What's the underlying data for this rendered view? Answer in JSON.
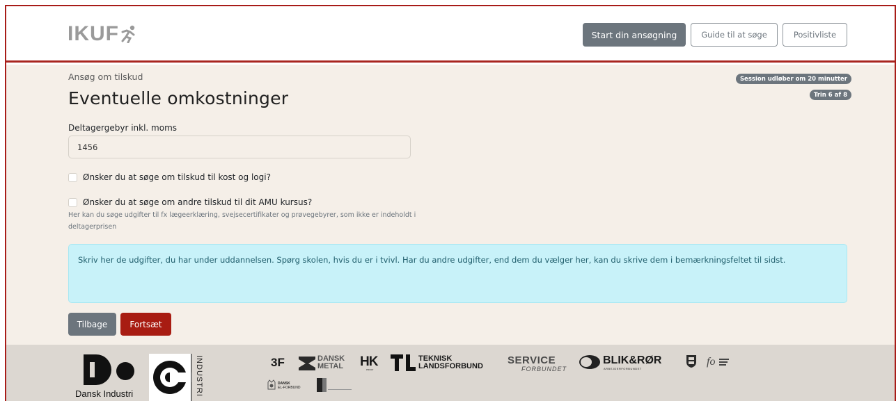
{
  "header": {
    "logo_text": "IKUF",
    "nav": {
      "start_label": "Start din ansøgning",
      "guide_label": "Guide til at søge",
      "list_label": "Positivliste"
    }
  },
  "main": {
    "breadcrumb": "Ansøg om tilskud",
    "title": "Eventuelle omkostninger",
    "session_badge": "Session udløber om 20 minutter",
    "step_badge": "Trin 6 af 8",
    "fee_field": {
      "label": "Deltagergebyr inkl. moms",
      "value": "1456"
    },
    "checkbox_1": {
      "label": "Ønsker du at søge om tilskud til kost og logi?",
      "checked": false
    },
    "checkbox_2": {
      "label": "Ønsker du at søge om andre tilskud til dit AMU kursus?",
      "checked": false,
      "help": "Her kan du søge udgifter til fx lægeerklæring, svejsecertifikater og prøvegebyrer, som ikke er indeholdt i deltagerprisen"
    },
    "info": "Skriv her de udgifter, du har under uddannelsen. Spørg skolen, hvis du er i tvivl. Har du andre udgifter, end dem du vælger her, kan du skrive dem i bemærkningsfeltet til sidst.",
    "buttons": {
      "back_label": "Tilbage",
      "next_label": "Fortsæt"
    }
  },
  "footer": {
    "partners": {
      "di_name": "Dansk Industri",
      "co_vertical_text": "INDUSTRI",
      "three_f": "3F",
      "dansk_metal_line1": "DANSK",
      "dansk_metal_line2": "METAL",
      "hk": "HK",
      "hk_sub": "PRIVAT",
      "tl_line1": "TEKNISK",
      "tl_line2": "LANDSFORBUND",
      "service_line1": "SERVICE",
      "service_line2": "FORBUNDET",
      "blikror": "BLIK&RØR",
      "blikror_sub": "ARBEJDERFORBUNDET",
      "elforbund_line1": "DANSK",
      "elforbund_line2": "EL-FORBUND"
    }
  }
}
